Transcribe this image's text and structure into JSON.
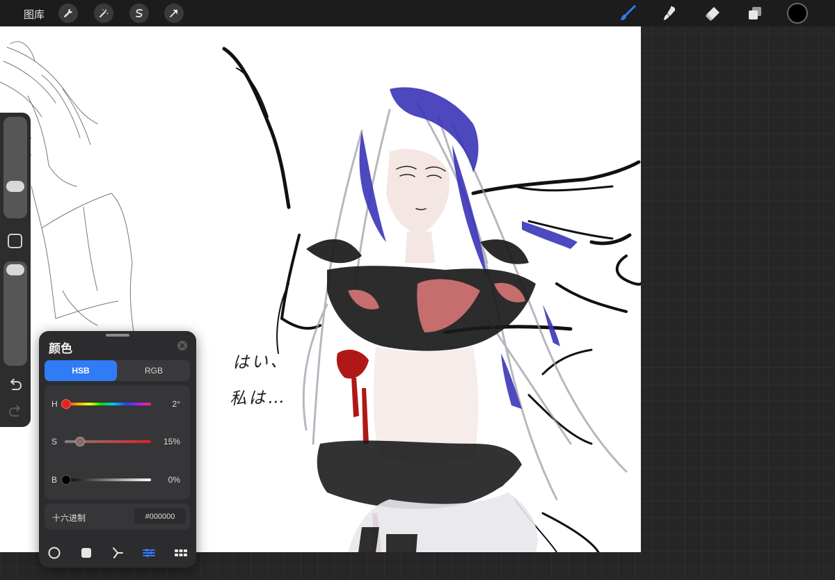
{
  "toolbar": {
    "gallery_label": "图库",
    "left_tools": [
      "wrench-icon",
      "magic-wand-icon",
      "selection-s-icon",
      "transform-arrow-icon"
    ],
    "right_tools": [
      "brush-icon",
      "smudge-icon",
      "eraser-icon",
      "layers-icon"
    ],
    "active_tool": "brush-icon",
    "active_color": "#000000",
    "active_tool_color": "#2f7cf6"
  },
  "canvas": {
    "handwriting_line1": "はい、",
    "handwriting_line2": "私は…"
  },
  "sidebar": {
    "brush_size_level": 0.45,
    "opacity_level": 0.96,
    "icons": [
      "modify-square-icon",
      "undo-icon",
      "redo-icon"
    ]
  },
  "color_panel": {
    "title": "颜色",
    "tabs": [
      {
        "label": "HSB",
        "active": true
      },
      {
        "label": "RGB",
        "active": false
      }
    ],
    "sliders": [
      {
        "key": "H",
        "value": "2°",
        "level": 0.0
      },
      {
        "key": "S",
        "value": "15%",
        "level": 0.15
      },
      {
        "key": "B",
        "value": "0%",
        "level": 0.0
      }
    ],
    "hex_label": "十六进制",
    "hex_value": "#000000",
    "footer_icons": [
      "disc-icon",
      "classic-square-icon",
      "harmony-icon",
      "value-sliders-icon",
      "palettes-grid-icon"
    ],
    "active_footer": "value-sliders-icon"
  }
}
